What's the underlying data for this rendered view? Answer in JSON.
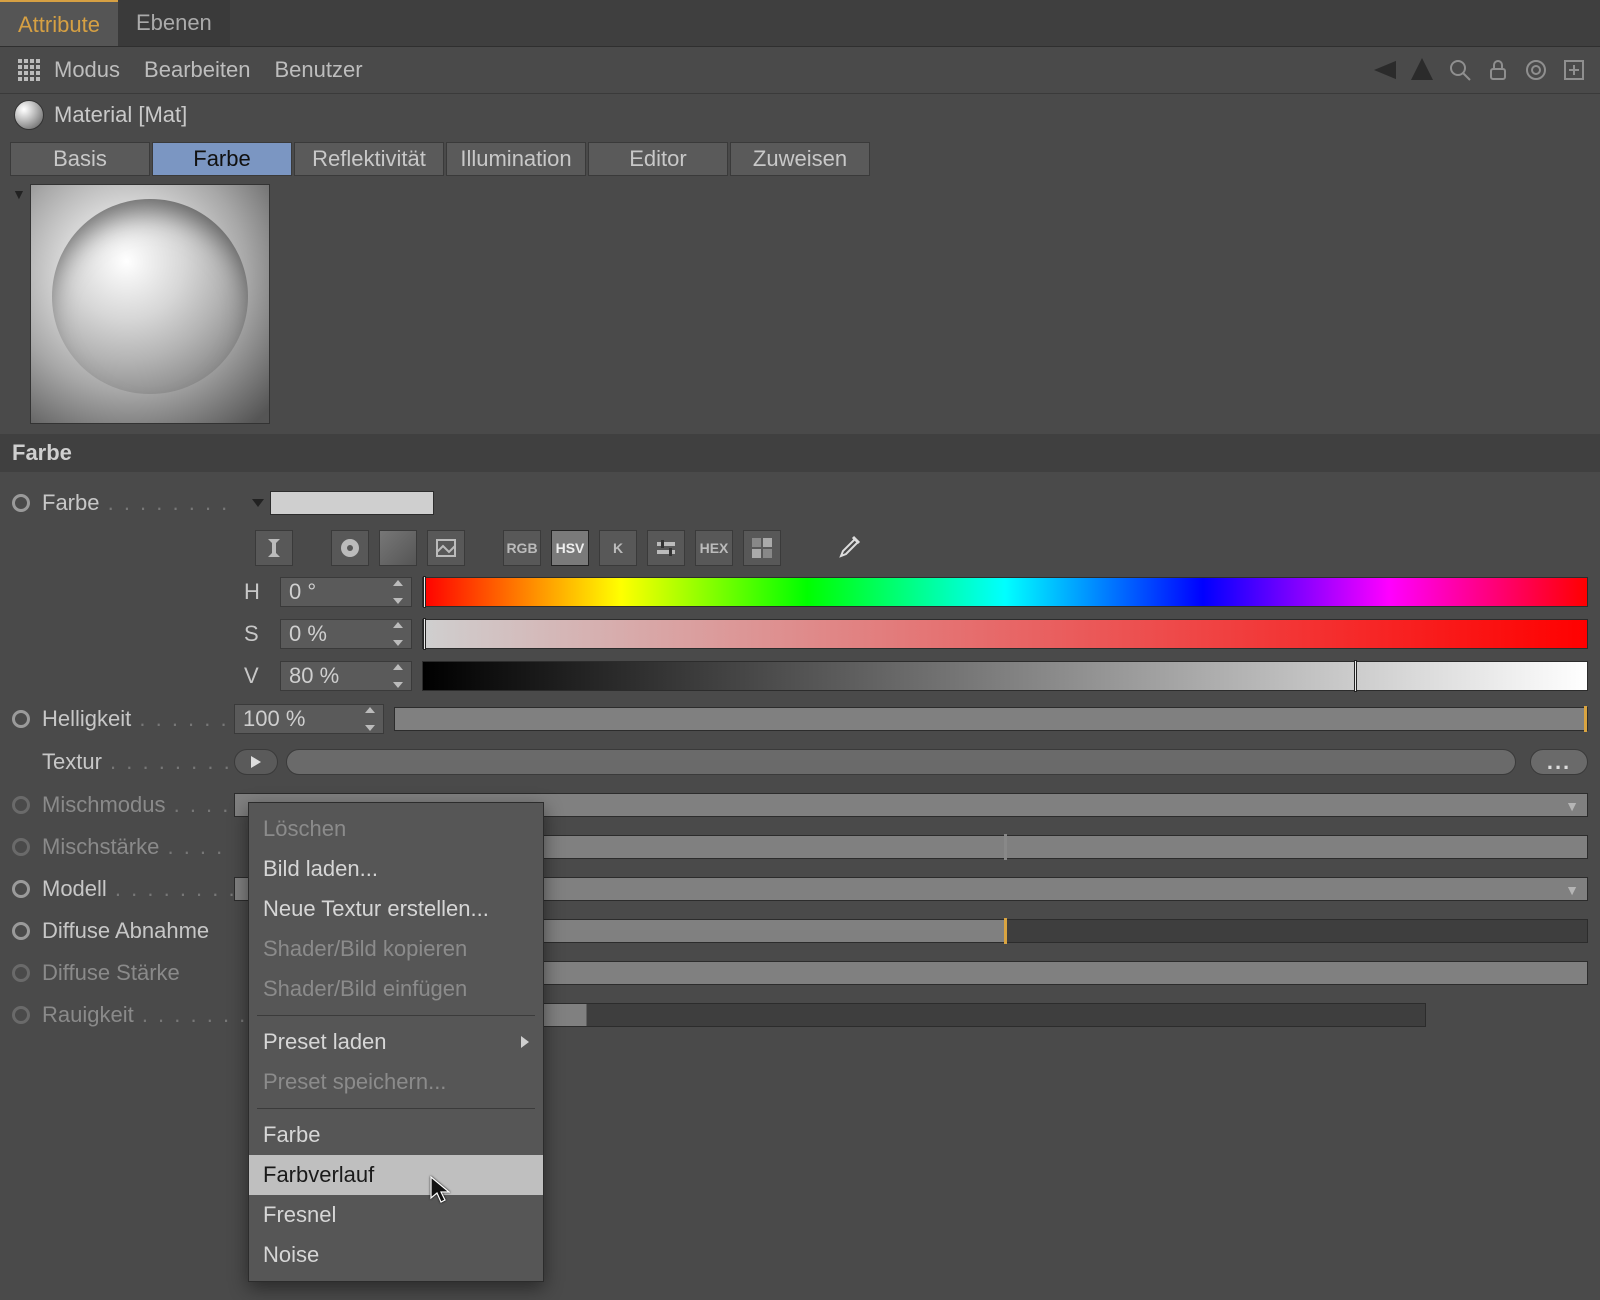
{
  "tabs": {
    "attribute": "Attribute",
    "layers": "Ebenen"
  },
  "toolbar": {
    "modus": "Modus",
    "bearbeiten": "Bearbeiten",
    "benutzer": "Benutzer"
  },
  "material": {
    "title": "Material [Mat]"
  },
  "subtabs": {
    "basis": "Basis",
    "farbe": "Farbe",
    "reflekt": "Reflektivität",
    "illum": "Illumination",
    "editor": "Editor",
    "zuweisen": "Zuweisen"
  },
  "section": {
    "farbe": "Farbe"
  },
  "labels": {
    "farbe": "Farbe",
    "helligkeit": "Helligkeit",
    "textur": "Textur",
    "mischmodus": "Mischmodus",
    "mischstaerke": "Mischstärke",
    "modell": "Modell",
    "diffuse_abnahme": "Diffuse Abnahme",
    "diffuse_staerke": "Diffuse Stärke",
    "rauigkeit": "Rauigkeit"
  },
  "hsv": {
    "H": "H",
    "S": "S",
    "V": "V",
    "h_val": "0 °",
    "s_val": "0 %",
    "v_val": "80 %"
  },
  "helligkeit_val": "100 %",
  "picker_modes": {
    "rgb": "RGB",
    "hsv": "HSV",
    "k": "K",
    "hex": "HEX"
  },
  "ellipsis": "...",
  "context_menu": {
    "loeschen": "Löschen",
    "bild_laden": "Bild laden...",
    "neue_textur": "Neue Textur erstellen...",
    "shader_kopieren": "Shader/Bild kopieren",
    "shader_einfuegen": "Shader/Bild einfügen",
    "preset_laden": "Preset laden",
    "preset_speichern": "Preset speichern...",
    "farbe": "Farbe",
    "farbverlauf": "Farbverlauf",
    "fresnel": "Fresnel",
    "noise": "Noise"
  }
}
